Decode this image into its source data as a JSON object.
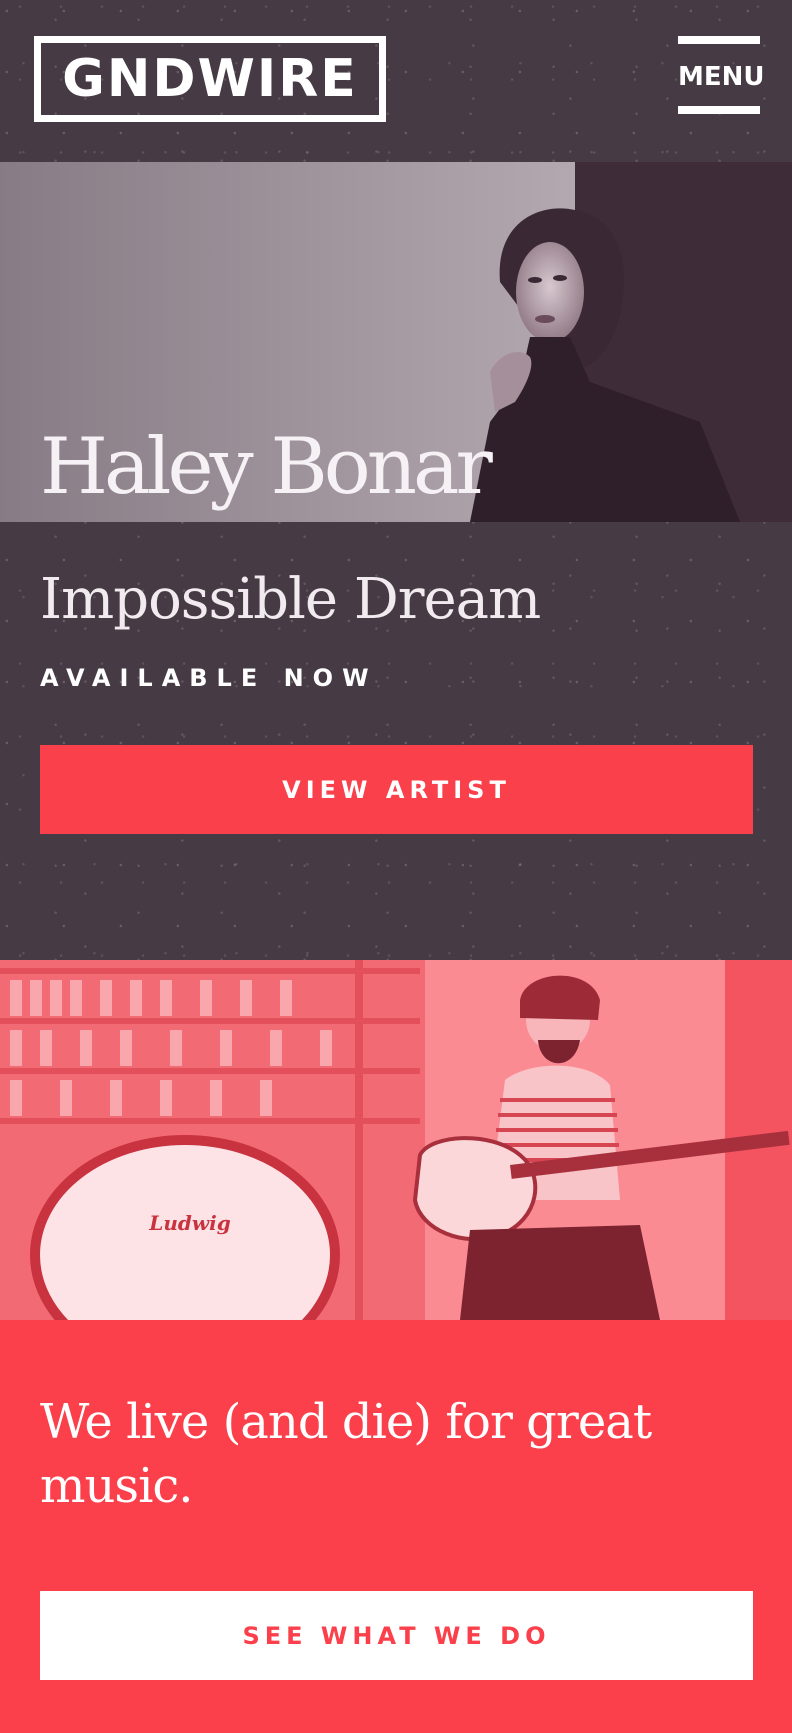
{
  "header": {
    "logo_text": "GNDWIRE",
    "menu_label": "MENU"
  },
  "hero": {
    "artist_name": "Haley Bonar",
    "album_title": "Impossible Dream",
    "availability": "AVAILABLE NOW",
    "cta_label": "VIEW ARTIST"
  },
  "mission": {
    "headline": "We live (and die) for great music.",
    "cta_label": "SEE WHAT WE DO",
    "drum_brand_text": "Ludwig"
  },
  "colors": {
    "background": "#463b45",
    "accent": "#fa404b",
    "text_light": "#ffffff"
  },
  "icons": {
    "menu": "hamburger-menu-icon"
  }
}
